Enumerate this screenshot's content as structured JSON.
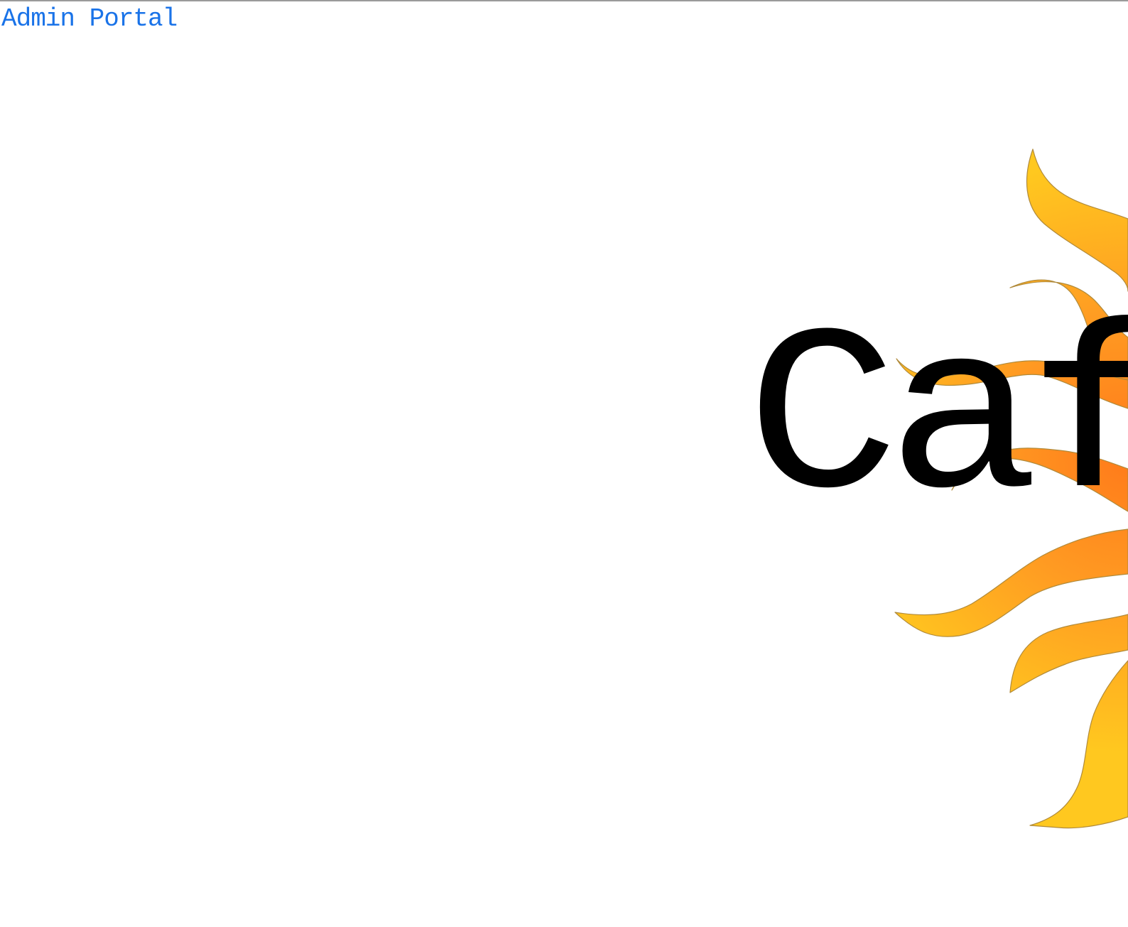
{
  "header": {
    "admin_link_label": "Admin Portal"
  },
  "hero": {
    "title": "Cafe",
    "logo_icon": "sun-icon"
  },
  "colors": {
    "link": "#1a73e8",
    "title": "#000000",
    "sun_outer": "#ffc61a",
    "sun_inner": "#ff8a1f",
    "background": "#ffffff"
  }
}
